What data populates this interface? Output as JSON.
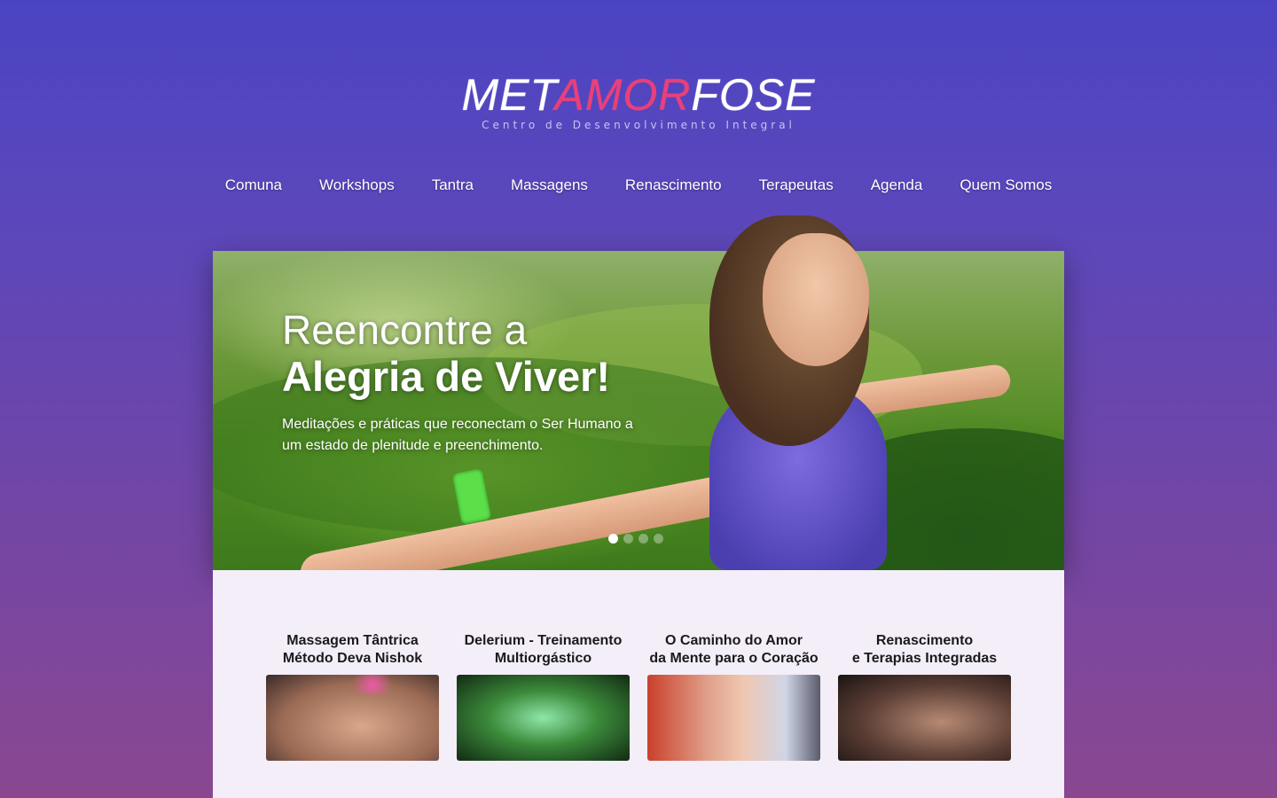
{
  "logo": {
    "part1": "MET",
    "part2": "AMOR",
    "part3": "FOSE",
    "tagline": "Centro de Desenvolvimento Integral"
  },
  "nav": [
    {
      "label": "Comuna"
    },
    {
      "label": "Workshops"
    },
    {
      "label": "Tantra"
    },
    {
      "label": "Massagens"
    },
    {
      "label": "Renascimento"
    },
    {
      "label": "Terapeutas"
    },
    {
      "label": "Agenda"
    },
    {
      "label": "Quem Somos"
    }
  ],
  "hero": {
    "line1": "Reencontre a",
    "line2": "Alegria de Viver!",
    "subtitle": "Meditações e práticas que reconectam o Ser Humano a um estado de plenitude e preenchimento.",
    "slides": 4,
    "active_slide": 1
  },
  "cards": [
    {
      "title_line1": "Massagem Tântrica",
      "title_line2": "Método Deva Nishok",
      "image": "massage-photo"
    },
    {
      "title_line1": "Delerium - Treinamento",
      "title_line2": "Multiorgástico",
      "image": "forest-silhouette-photo"
    },
    {
      "title_line1": "O Caminho do Amor",
      "title_line2": "da Mente para o Coração",
      "image": "group-hug-photo"
    },
    {
      "title_line1": "Renascimento",
      "title_line2": "e Terapias Integradas",
      "image": "rebirthing-photo"
    }
  ],
  "colors": {
    "background_top": "#4b44c2",
    "background_bottom": "#8a4790",
    "logo_accent": "#e8407a",
    "panel": "#f3eef8"
  }
}
